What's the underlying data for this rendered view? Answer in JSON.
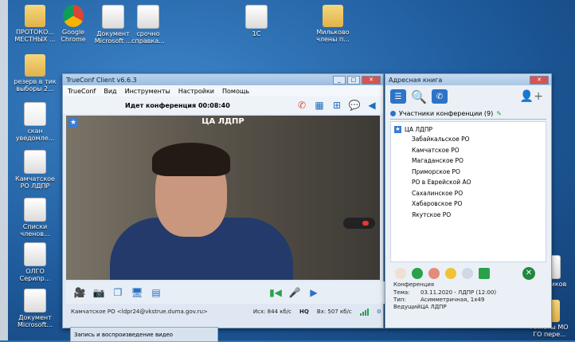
{
  "desktop": {
    "icons": [
      {
        "label": "ПРОТОКО...\nМЕСТНЫХ ...",
        "icon": "folder-icon"
      },
      {
        "label": "Google Chrome",
        "icon": "chrome-icon"
      },
      {
        "label": "Документ Microsoft ...",
        "icon": "document-icon"
      },
      {
        "label": "срочно справка...",
        "icon": "document-icon"
      },
      {
        "label": "1С",
        "icon": "document-icon"
      },
      {
        "label": "Мильково члены п...",
        "icon": "folder-icon"
      },
      {
        "label": "резерв в тик выборы 2...",
        "icon": "folder-icon"
      },
      {
        "label": "скан уведомле...",
        "icon": "pdf-icon"
      },
      {
        "label": "Камчатское РО ЛДПР",
        "icon": "document-icon"
      },
      {
        "label": "Списки членов...",
        "icon": "document-icon"
      },
      {
        "label": "ОЛГО Серипр...",
        "icon": "document-icon"
      },
      {
        "label": "Документ Microsoft...",
        "icon": "document-icon"
      },
      {
        "label": "Чашников",
        "icon": "document-icon"
      },
      {
        "label": "Анкеты МО ГО пере...",
        "icon": "folder-icon"
      }
    ]
  },
  "trueconf": {
    "title": "TrueConf Client v6.6.3",
    "menu": [
      "TrueConf",
      "Вид",
      "Инструменты",
      "Настройки",
      "Помощь"
    ],
    "status": "Идет конференция 00:08:40",
    "video_caption": "ЦА ЛДПР",
    "status_bar": {
      "participant": "Камчатское РО <ldpr24@vkstrue.duma.gov.ru>",
      "out_rate": "Исх: 844 кб/с",
      "hq": "HQ",
      "in_rate": "Вх: 507 кб/с"
    }
  },
  "address_book": {
    "title": "Адресная книга",
    "tab": "Участники конференции (9)",
    "root": "ЦА ЛДПР",
    "participants": [
      "Забайкальское РО",
      "Камчатское РО",
      "Магаданское РО",
      "Приморское РО",
      "РО в Еврейской АО",
      "Сахалинское РО",
      "Хабаровское РО",
      "Якутское РО"
    ],
    "conference": {
      "heading": "Конференция",
      "rows": [
        {
          "k": "Тема:",
          "v": "03.11.2020 - ЛДПР (12:00)"
        },
        {
          "k": "Тип:",
          "v": "Асимметричная, 1x49"
        },
        {
          "k": "Ведущий:",
          "v": "ЦА ЛДПР"
        }
      ]
    }
  },
  "taskbar": {
    "record_label": "Запись и воспроизведение видео"
  }
}
